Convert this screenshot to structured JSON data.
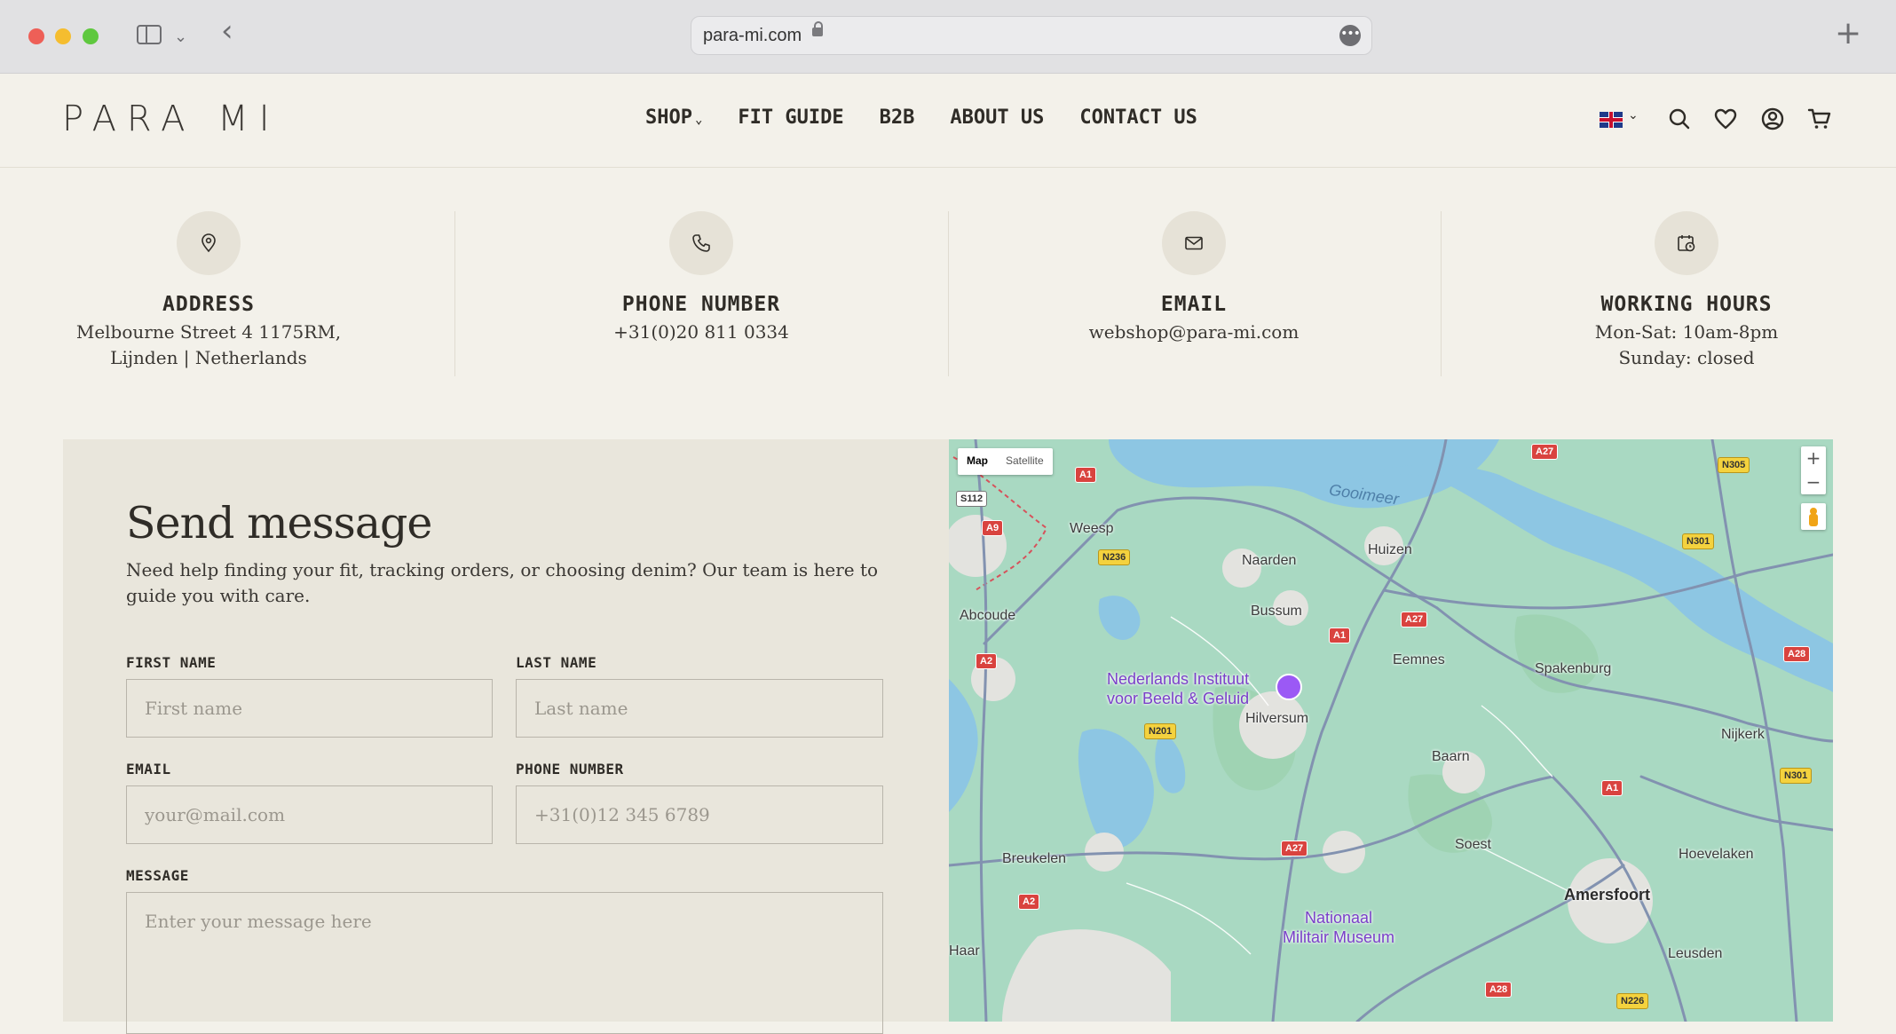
{
  "browser": {
    "url": "para-mi.com",
    "icons": [
      "sidebar-icon",
      "chevron-down-icon",
      "back-arrow-icon",
      "lock-icon",
      "more-icon",
      "plus-icon"
    ]
  },
  "header": {
    "logo": "PARA MI",
    "nav": [
      {
        "label": "SHOP",
        "has_dropdown": true
      },
      {
        "label": "FIT GUIDE"
      },
      {
        "label": "B2B"
      },
      {
        "label": "ABOUT US"
      },
      {
        "label": "CONTACT US"
      }
    ],
    "icons": [
      "uk-flag-icon",
      "search-icon",
      "heart-icon",
      "account-icon",
      "cart-icon"
    ]
  },
  "contact": {
    "address": {
      "title": "ADDRESS",
      "line1": "Melbourne Street 4 1175RM,",
      "line2": "Lijnden | Netherlands",
      "icon": "location-pin-icon"
    },
    "phone": {
      "title": "PHONE NUMBER",
      "line1": "+31(0)20 811 0334",
      "icon": "phone-icon"
    },
    "email": {
      "title": "EMAIL",
      "line1": "webshop@para-mi.com",
      "icon": "mail-icon"
    },
    "hours": {
      "title": "WORKING HOURS",
      "line1": "Mon-Sat: 10am-8pm",
      "line2": "Sunday: closed",
      "icon": "calendar-clock-icon"
    }
  },
  "form": {
    "title": "Send message",
    "description": "Need help finding your fit, tracking orders, or choosing denim? Our team is here to guide you with care.",
    "first_name": {
      "label": "FIRST NAME",
      "placeholder": "First name"
    },
    "last_name": {
      "label": "LAST NAME",
      "placeholder": "Last name"
    },
    "email": {
      "label": "EMAIL",
      "placeholder": "your@mail.com"
    },
    "phone": {
      "label": "PHONE NUMBER",
      "placeholder": "+31(0)12 345 6789"
    },
    "message": {
      "label": "MESSAGE",
      "placeholder": "Enter your message here"
    }
  },
  "map": {
    "type_map": "Map",
    "type_satellite": "Satellite",
    "zoom_in": "+",
    "zoom_out": "−",
    "places": {
      "weesp": "Weesp",
      "naarden": "Naarden",
      "huizen": "Huizen",
      "bussum": "Bussum",
      "abcoude": "Abcoude",
      "eemnes": "Eemnes",
      "spakenburg": "Spakenburg",
      "hilversum": "Hilversum",
      "nijkerk": "Nijkerk",
      "baarn": "Baarn",
      "soest": "Soest",
      "hoevelaken": "Hoevelaken",
      "breukelen": "Breukelen",
      "amersfoort": "Amersfoort",
      "leusden": "Leusden",
      "gooimeer": "Gooimeer",
      "haar": "Haar"
    },
    "poi1_line1": "Nederlands Instituut",
    "poi1_line2": "voor Beeld & Geluid",
    "poi2_line1": "Nationaal",
    "poi2_line2": "Militair Museum",
    "roads": {
      "a1a": "A1",
      "a1b": "A1",
      "a1c": "A1",
      "a9": "A9",
      "a2a": "A2",
      "a2b": "A2",
      "a27a": "A27",
      "a27b": "A27",
      "a27c": "A27",
      "a28a": "A28",
      "a28b": "A28",
      "n236": "N236",
      "n201": "N201",
      "n305": "N305",
      "n301a": "N301",
      "n301b": "N301",
      "n226": "N226",
      "s112": "S112"
    }
  }
}
